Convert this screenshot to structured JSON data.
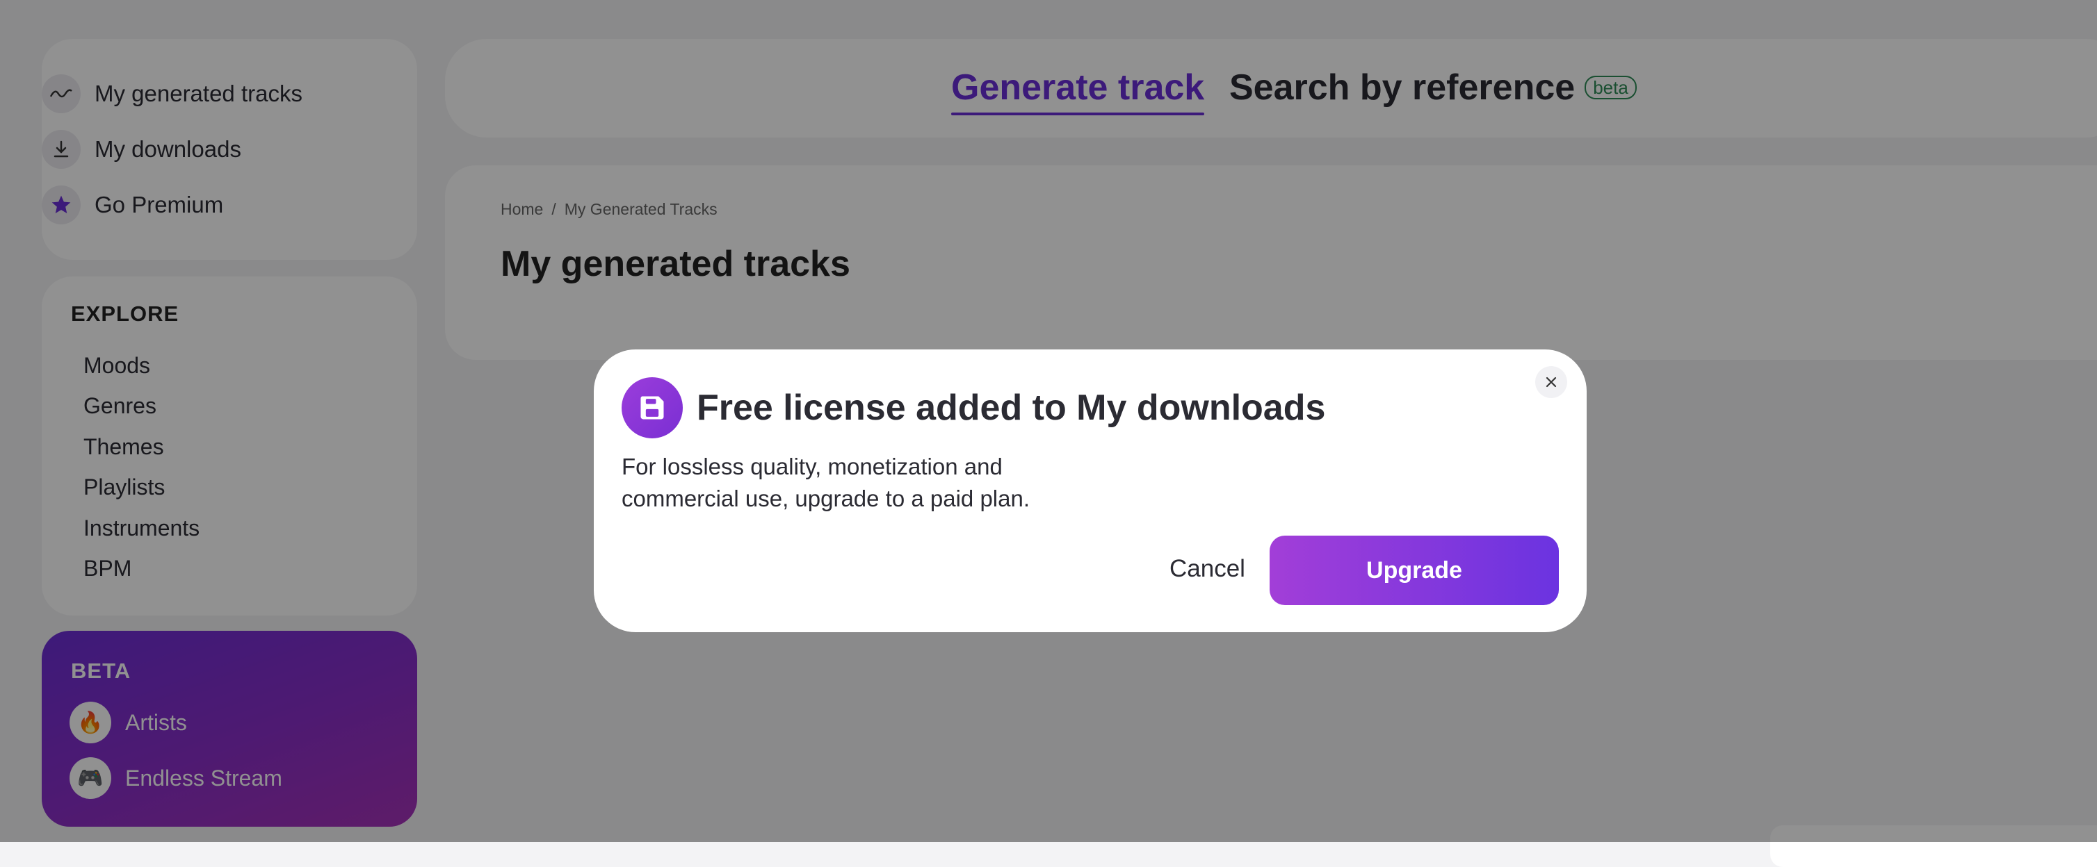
{
  "sidebar": {
    "items": [
      {
        "label": "My generated tracks",
        "icon": "waveform-icon"
      },
      {
        "label": "My downloads",
        "icon": "download-icon"
      },
      {
        "label": "Go Premium",
        "icon": "star-icon"
      }
    ]
  },
  "explore": {
    "title": "EXPLORE",
    "items": [
      "Moods",
      "Genres",
      "Themes",
      "Playlists",
      "Instruments",
      "BPM"
    ]
  },
  "beta": {
    "title": "BETA",
    "items": [
      {
        "label": "Artists",
        "icon": "fire-icon",
        "glyph": "🔥"
      },
      {
        "label": "Endless Stream",
        "icon": "gamepad-icon",
        "glyph": "🎮"
      }
    ]
  },
  "tabs": {
    "generate": "Generate track",
    "search": "Search by reference",
    "badge": "beta"
  },
  "breadcrumb": {
    "home": "Home",
    "separator": "/",
    "current": "My Generated Tracks"
  },
  "page": {
    "title": "My generated tracks"
  },
  "modal": {
    "title": "Free license added to My downloads",
    "body": "For lossless quality, monetization and commercial use, upgrade to a paid plan.",
    "cancel_label": "Cancel",
    "upgrade_label": "Upgrade",
    "icon": "save-icon"
  },
  "colors": {
    "accent": "#6a2fd6",
    "gradient_start": "#a23ed8",
    "gradient_end": "#6b33e0",
    "beta_badge": "#2e8b57",
    "overlay": "rgba(0,0,0,0.43)"
  }
}
